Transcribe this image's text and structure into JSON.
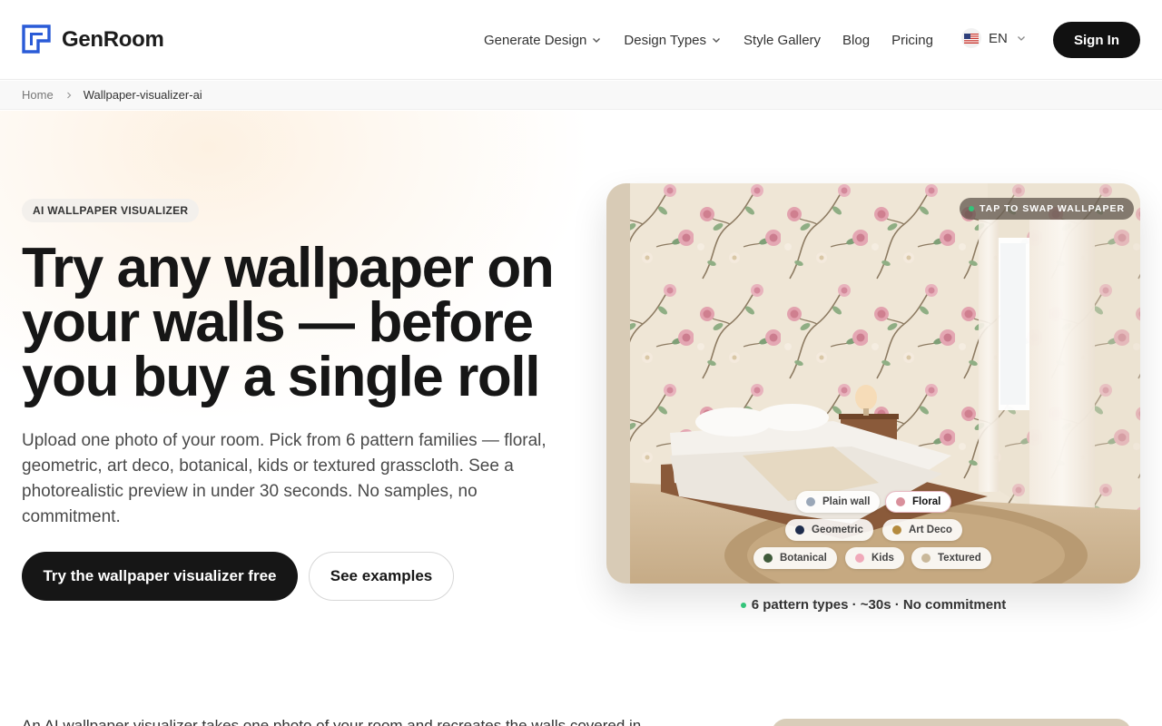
{
  "brand": {
    "name": "GenRoom",
    "accent": "#2a5bd7"
  },
  "nav": {
    "items": [
      {
        "label": "Generate Design",
        "dropdown": true
      },
      {
        "label": "Design Types",
        "dropdown": true
      },
      {
        "label": "Style Gallery",
        "dropdown": false
      },
      {
        "label": "Blog",
        "dropdown": false
      },
      {
        "label": "Pricing",
        "dropdown": false
      }
    ],
    "language": "EN",
    "sign_in": "Sign In"
  },
  "breadcrumb": {
    "home": "Home",
    "current": "Wallpaper-visualizer-ai"
  },
  "hero": {
    "badge": "AI WALLPAPER VISUALIZER",
    "headline": "Try any wallpaper on your walls — before you buy a single roll",
    "subtext": "Upload one photo of your room. Pick from 6 pattern families — floral, geometric, art deco, botanical, kids or textured grasscloth. See a photorealistic preview in under 30 seconds. No samples, no commitment.",
    "cta_primary": "Try the wallpaper visualizer free",
    "cta_secondary": "See examples"
  },
  "visual": {
    "tag": "TAP TO SWAP WALLPAPER",
    "chips": [
      {
        "label": "Plain wall",
        "color": "#9aa7b8",
        "active": false
      },
      {
        "label": "Floral",
        "color": "#d9909c",
        "active": true
      },
      {
        "label": "Geometric",
        "color": "#1f2d4d",
        "active": false
      },
      {
        "label": "Art Deco",
        "color": "#b48a3e",
        "active": false
      },
      {
        "label": "Botanical",
        "color": "#3f5a3a",
        "active": false
      },
      {
        "label": "Kids",
        "color": "#f0a9b9",
        "active": false
      },
      {
        "label": "Textured",
        "color": "#c9b89a",
        "active": false
      }
    ],
    "caption": "6 pattern types · ~30s · No commitment"
  },
  "below": {
    "text": "An AI wallpaper visualizer takes one photo of your room and recreates the walls covered in..."
  }
}
